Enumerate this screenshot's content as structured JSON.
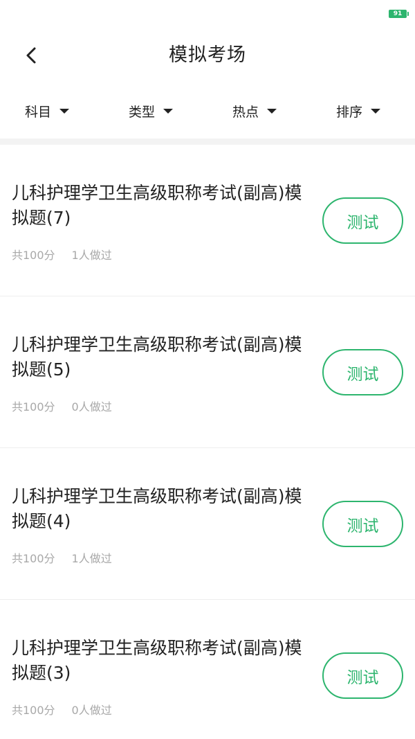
{
  "status_bar": {
    "battery": "91"
  },
  "header": {
    "title": "模拟考场"
  },
  "filters": [
    {
      "label": "科目"
    },
    {
      "label": "类型"
    },
    {
      "label": "热点"
    },
    {
      "label": "排序"
    }
  ],
  "exams": [
    {
      "title": "儿科护理学卫生高级职称考试(副高)模拟题(7)",
      "score": "共100分",
      "taken": "1人做过",
      "action": "测试"
    },
    {
      "title": "儿科护理学卫生高级职称考试(副高)模拟题(5)",
      "score": "共100分",
      "taken": "0人做过",
      "action": "测试"
    },
    {
      "title": "儿科护理学卫生高级职称考试(副高)模拟题(4)",
      "score": "共100分",
      "taken": "1人做过",
      "action": "测试"
    },
    {
      "title": "儿科护理学卫生高级职称考试(副高)模拟题(3)",
      "score": "共100分",
      "taken": "0人做过",
      "action": "测试"
    }
  ],
  "colors": {
    "accent": "#2db56e",
    "meta_text": "#a8a8a8",
    "title_text": "#222222"
  }
}
